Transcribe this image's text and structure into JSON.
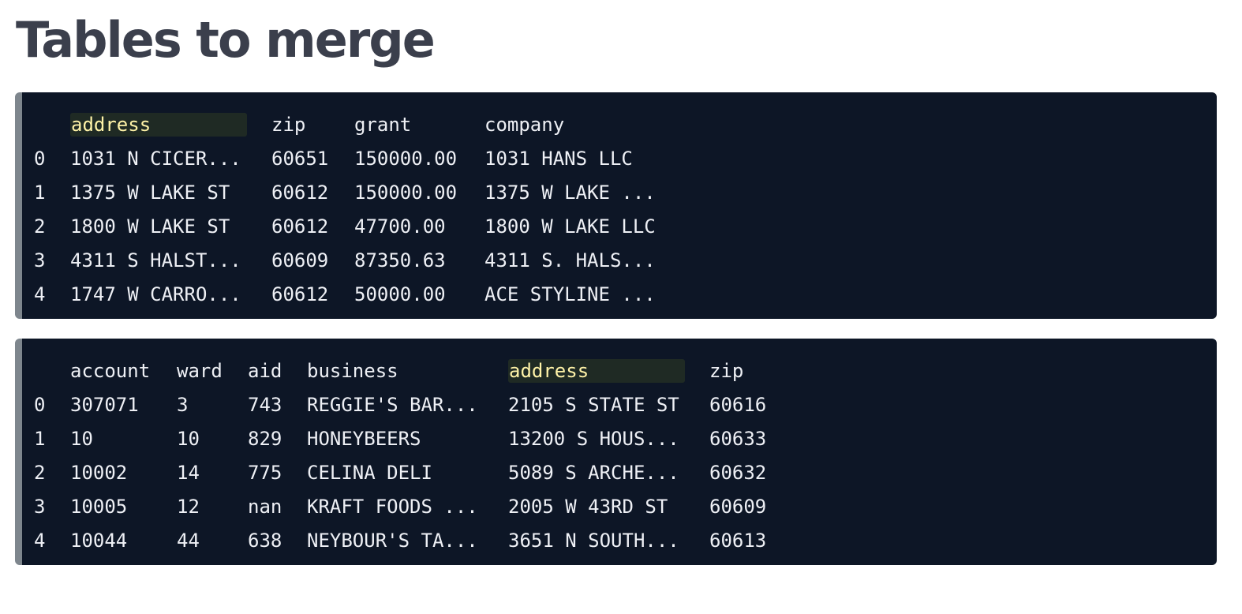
{
  "page": {
    "title": "Tables to merge"
  },
  "table_1": {
    "columns": [
      "",
      "address",
      "zip",
      "grant",
      "company"
    ],
    "highlighted_column": "address",
    "rows": [
      [
        "0",
        "1031 N CICER...",
        "60651",
        "150000.00",
        "1031 HANS LLC"
      ],
      [
        "1",
        "1375 W LAKE ST",
        "60612",
        "150000.00",
        "1375 W LAKE ..."
      ],
      [
        "2",
        "1800 W LAKE ST",
        "60612",
        "47700.00",
        "1800 W LAKE LLC"
      ],
      [
        "3",
        "4311 S HALST...",
        "60609",
        "87350.63",
        "4311 S. HALS..."
      ],
      [
        "4",
        "1747 W CARRO...",
        "60612",
        "50000.00",
        "ACE STYLINE ..."
      ]
    ]
  },
  "table_2": {
    "columns": [
      "",
      "account",
      "ward",
      "aid",
      "business",
      "address",
      "zip"
    ],
    "highlighted_column": "address",
    "rows": [
      [
        "0",
        "307071",
        "3",
        "743",
        "REGGIE'S BAR...",
        "2105 S STATE ST",
        "60616"
      ],
      [
        "1",
        "10",
        "10",
        "829",
        "HONEYBEERS",
        "13200 S HOUS...",
        "60633"
      ],
      [
        "2",
        "10002",
        "14",
        "775",
        "CELINA DELI",
        "5089 S ARCHE...",
        "60632"
      ],
      [
        "3",
        "10005",
        "12",
        "nan",
        "KRAFT FOODS ...",
        "2005 W 43RD ST",
        "60609"
      ],
      [
        "4",
        "10044",
        "44",
        "638",
        "NEYBOUR'S TA...",
        "3651 N SOUTH...",
        "60613"
      ]
    ]
  },
  "colors": {
    "title": "#3b3f4c",
    "code_background": "#0d1626",
    "code_border": "#7e868d",
    "code_text": "#eef0f5",
    "highlight_text": "#fff3a8"
  }
}
